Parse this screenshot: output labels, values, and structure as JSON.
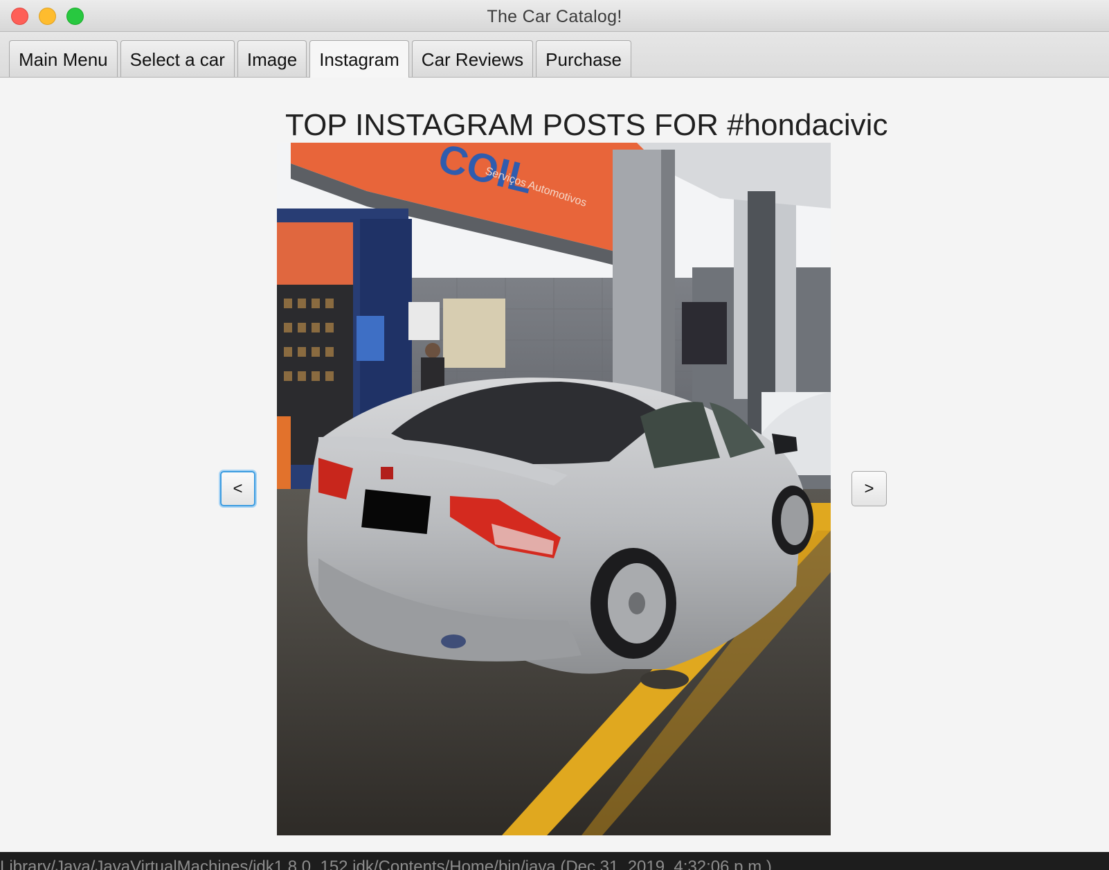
{
  "window": {
    "title": "The Car Catalog!"
  },
  "tabs": [
    {
      "label": "Main Menu"
    },
    {
      "label": "Select a car"
    },
    {
      "label": "Image"
    },
    {
      "label": "Instagram",
      "active": true
    },
    {
      "label": "Car Reviews"
    },
    {
      "label": "Purchase"
    }
  ],
  "main": {
    "heading": "TOP INSTAGRAM POSTS FOR #hondacivic",
    "prev_label": "<",
    "next_label": ">"
  },
  "photo": {
    "sign_brand": "COIL",
    "sign_subtitle": "Serviços Automotivos"
  },
  "status": {
    "text": "Library/Java/JavaVirtualMachines/jdk1.8.0_152.jdk/Contents/Home/bin/java (Dec 31, 2019, 4:32:06 p.m.)"
  },
  "colors": {
    "accent": "#3a9be0",
    "sign_orange": "#e8653a",
    "lane_yellow": "#e0a81f"
  }
}
